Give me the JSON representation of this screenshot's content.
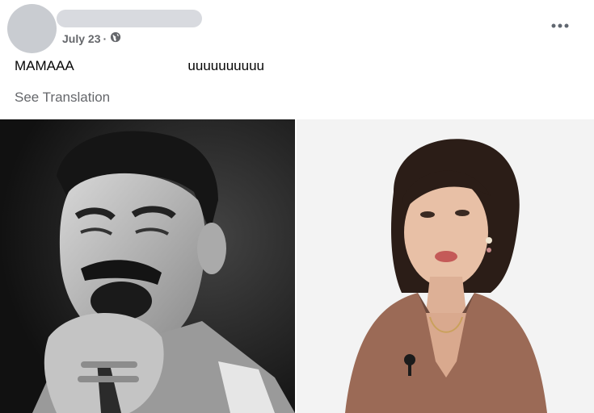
{
  "post": {
    "date": "July 23",
    "separator": "·",
    "text": "MAMAAA                              uuuuuuuuuu",
    "see_translation": "See Translation"
  },
  "icons": {
    "privacy": "globe-icon",
    "more": "more-options-icon"
  },
  "photos": [
    {
      "subject": "black-and-white photo of a singer with microphone"
    },
    {
      "subject": "photo of a woman in a brown blazer"
    }
  ],
  "colors": {
    "meta_text": "#65676b",
    "body_text": "#050505",
    "placeholder": "#d8dadf"
  }
}
